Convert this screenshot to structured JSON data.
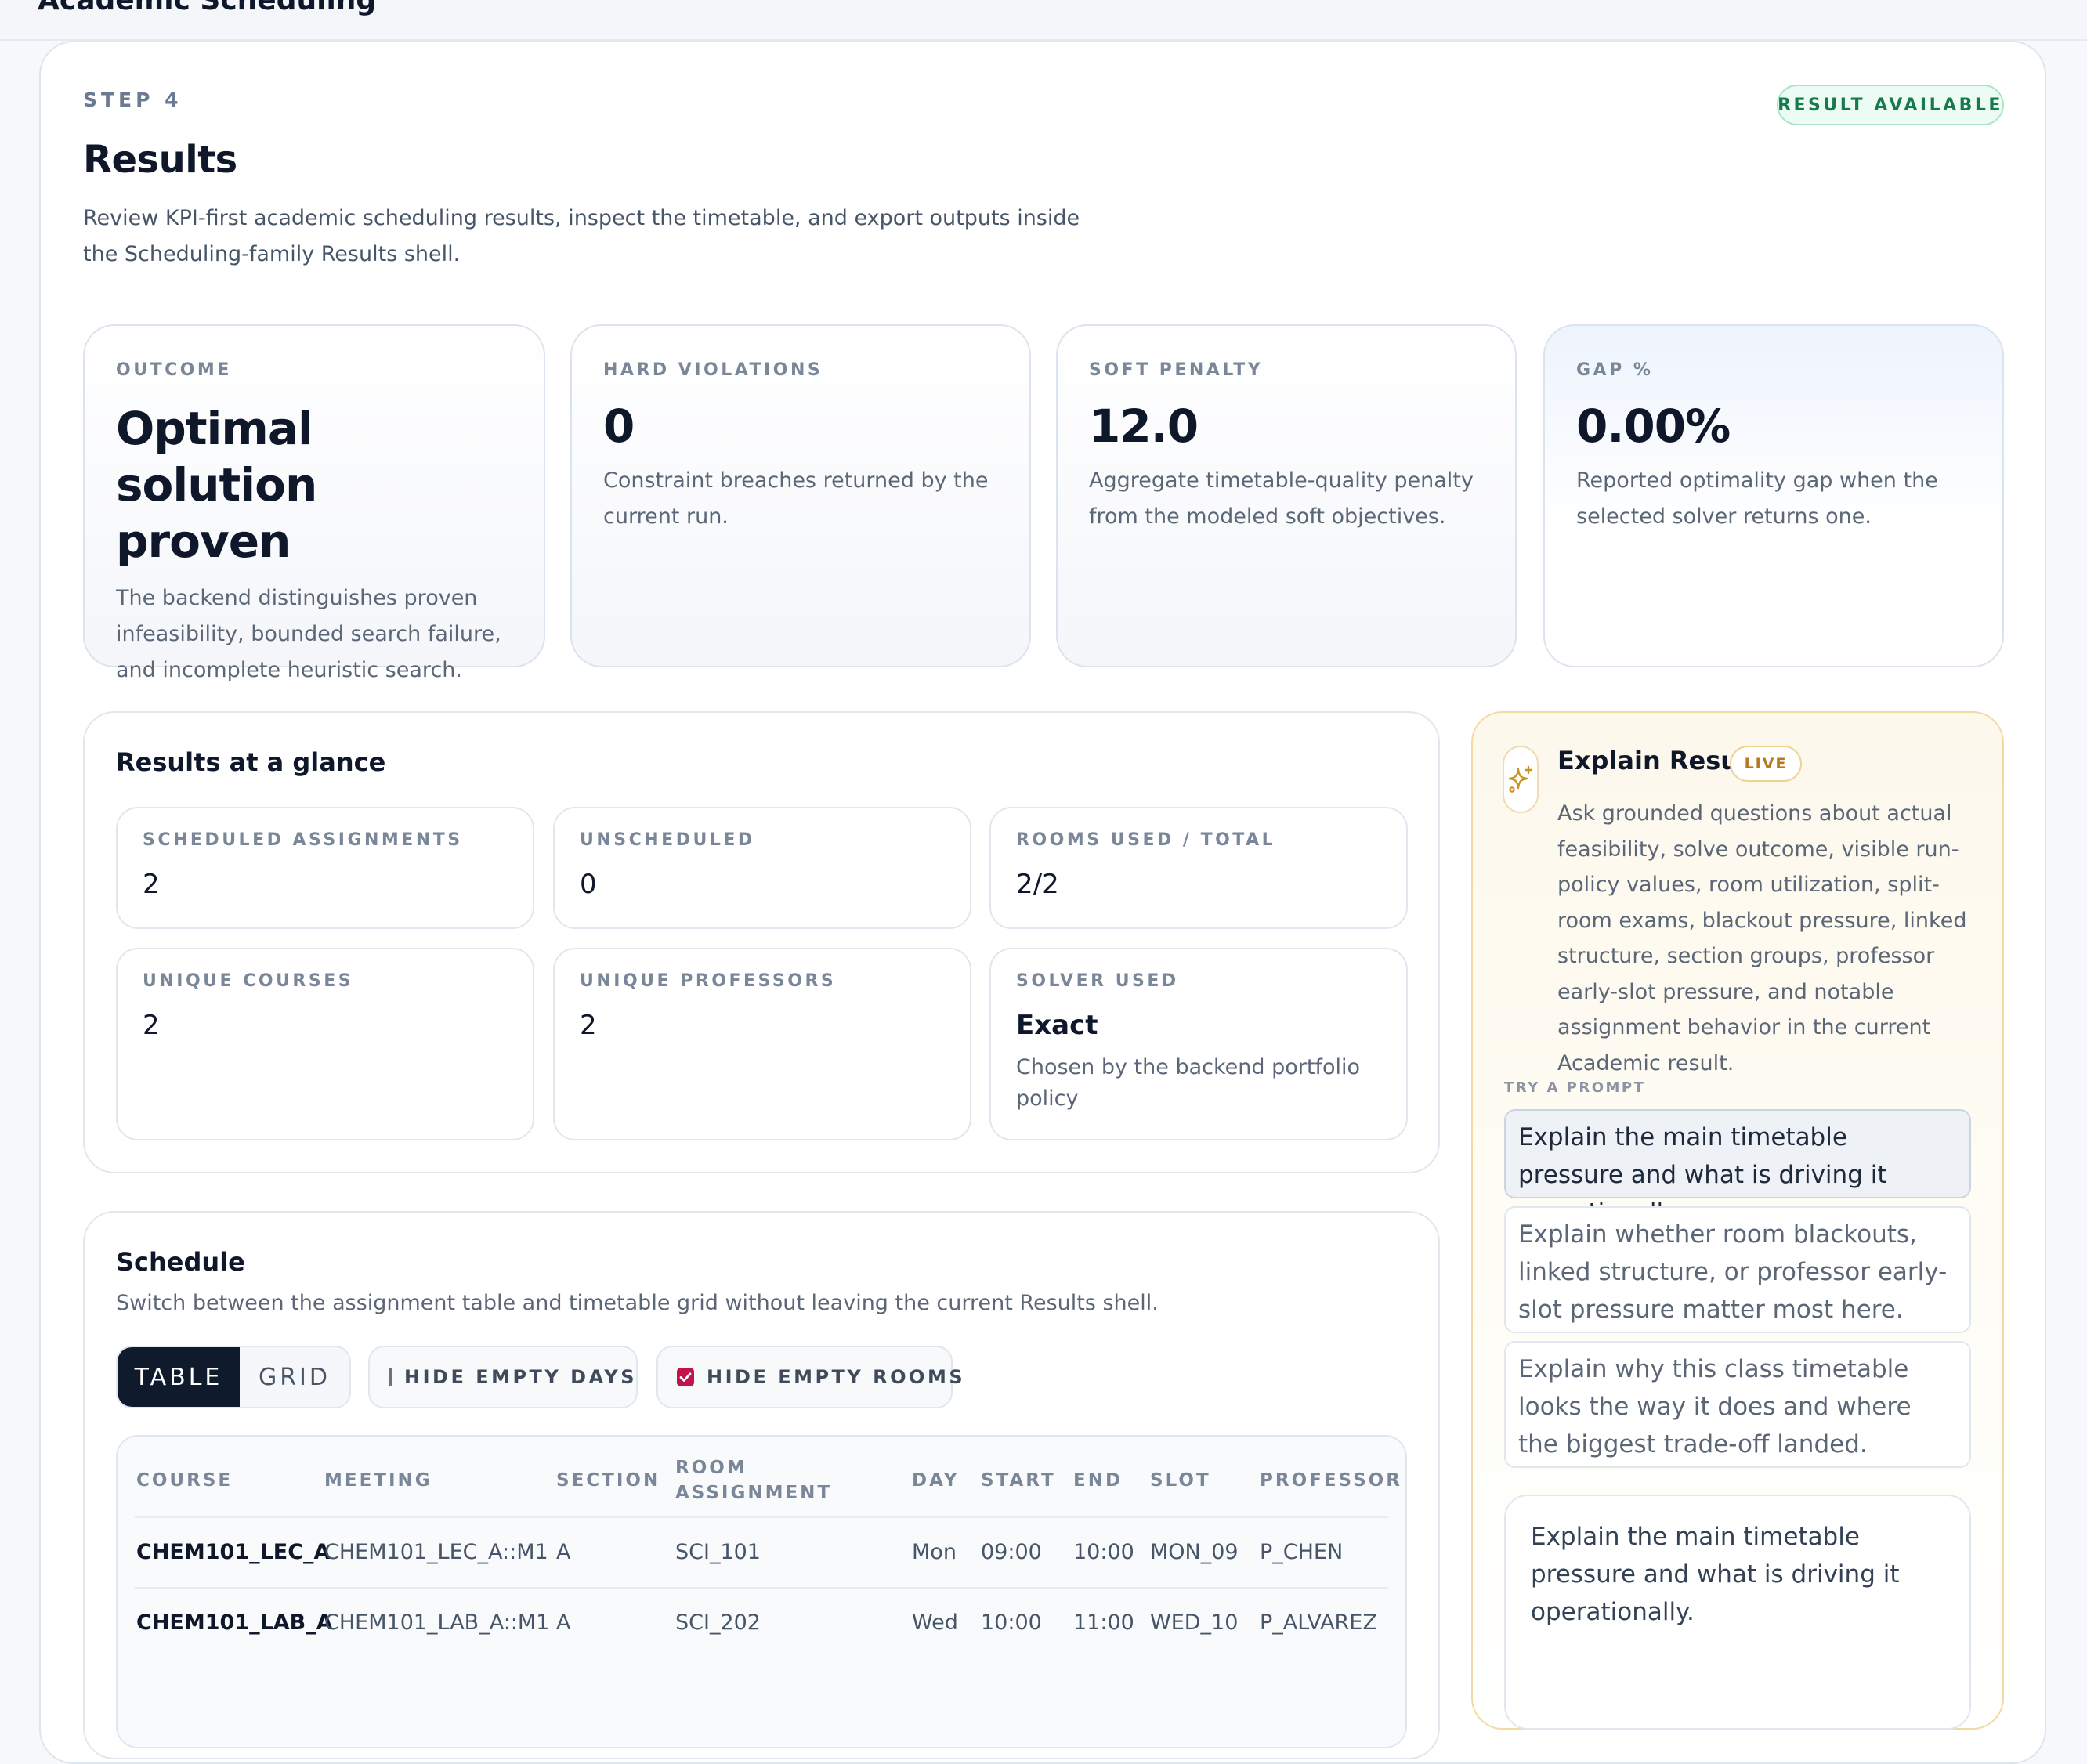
{
  "app": {
    "title": "Academic Scheduling"
  },
  "header": {
    "step": "STEP 4",
    "status_badge": "RESULT AVAILABLE",
    "title": "Results",
    "description": "Review KPI-first academic scheduling results, inspect the timetable, and export outputs inside the Scheduling-family Results shell."
  },
  "kpis": [
    {
      "label": "OUTCOME",
      "value": "Optimal solution proven",
      "desc": "The backend distinguishes proven infeasibility, bounded search failure, and incomplete heuristic search."
    },
    {
      "label": "HARD VIOLATIONS",
      "value": "0",
      "desc": "Constraint breaches returned by the current run."
    },
    {
      "label": "SOFT PENALTY",
      "value": "12.0",
      "desc": "Aggregate timetable-quality penalty from the modeled soft objectives."
    },
    {
      "label": "GAP %",
      "value": "0.00%",
      "desc": "Reported optimality gap when the selected solver returns one."
    }
  ],
  "glance": {
    "title": "Results at a glance",
    "stats": [
      {
        "label": "SCHEDULED ASSIGNMENTS",
        "value": "2"
      },
      {
        "label": "UNSCHEDULED",
        "value": "0"
      },
      {
        "label": "ROOMS USED / TOTAL",
        "value": "2/2"
      },
      {
        "label": "UNIQUE COURSES",
        "value": "2"
      },
      {
        "label": "UNIQUE PROFESSORS",
        "value": "2"
      },
      {
        "label": "SOLVER USED",
        "value": "Exact",
        "note": "Chosen by the backend portfolio policy"
      }
    ]
  },
  "schedule": {
    "title": "Schedule",
    "subtitle": "Switch between the assignment table and timetable grid without leaving the current Results shell.",
    "view_table": "TABLE",
    "view_grid": "GRID",
    "hide_empty_days": {
      "label": "HIDE EMPTY DAYS",
      "checked": false
    },
    "hide_empty_rooms": {
      "label": "HIDE EMPTY ROOMS",
      "checked": true
    },
    "columns": [
      "COURSE",
      "MEETING",
      "SECTION",
      "ROOM ASSIGNMENT",
      "DAY",
      "START",
      "END",
      "SLOT",
      "PROFESSOR"
    ],
    "rows": [
      [
        "CHEM101_LEC_A",
        "CHEM101_LEC_A::M1",
        "A",
        "SCI_101",
        "Mon",
        "09:00",
        "10:00",
        "MON_09",
        "P_CHEN"
      ],
      [
        "CHEM101_LAB_A",
        "CHEM101_LAB_A::M1",
        "A",
        "SCI_202",
        "Wed",
        "10:00",
        "11:00",
        "WED_10",
        "P_ALVAREZ"
      ]
    ]
  },
  "explain": {
    "title": "Explain Result",
    "badge": "LIVE",
    "icon": "sparkle-icon",
    "description": "Ask grounded questions about actual feasibility, solve outcome, visible run-policy values, room utilization, split-room exams, blackout pressure, linked structure, section groups, professor early-slot pressure, and notable assignment behavior in the current Academic result.",
    "try_label": "TRY A PROMPT",
    "prompts": [
      "Explain the main timetable pressure and what is driving it operationally.",
      "Explain whether room blackouts, linked structure, or professor early-slot pressure matter most here.",
      "Explain why this class timetable looks the way it does and where the biggest trade-off landed."
    ],
    "input_value": "Explain the main timetable pressure and what is driving it operationally."
  },
  "colors": {
    "accent_dark": "#0f1b2d",
    "checkbox": "#c0144a",
    "badge_green": "#167a4c",
    "live_amber": "#b7791f"
  }
}
